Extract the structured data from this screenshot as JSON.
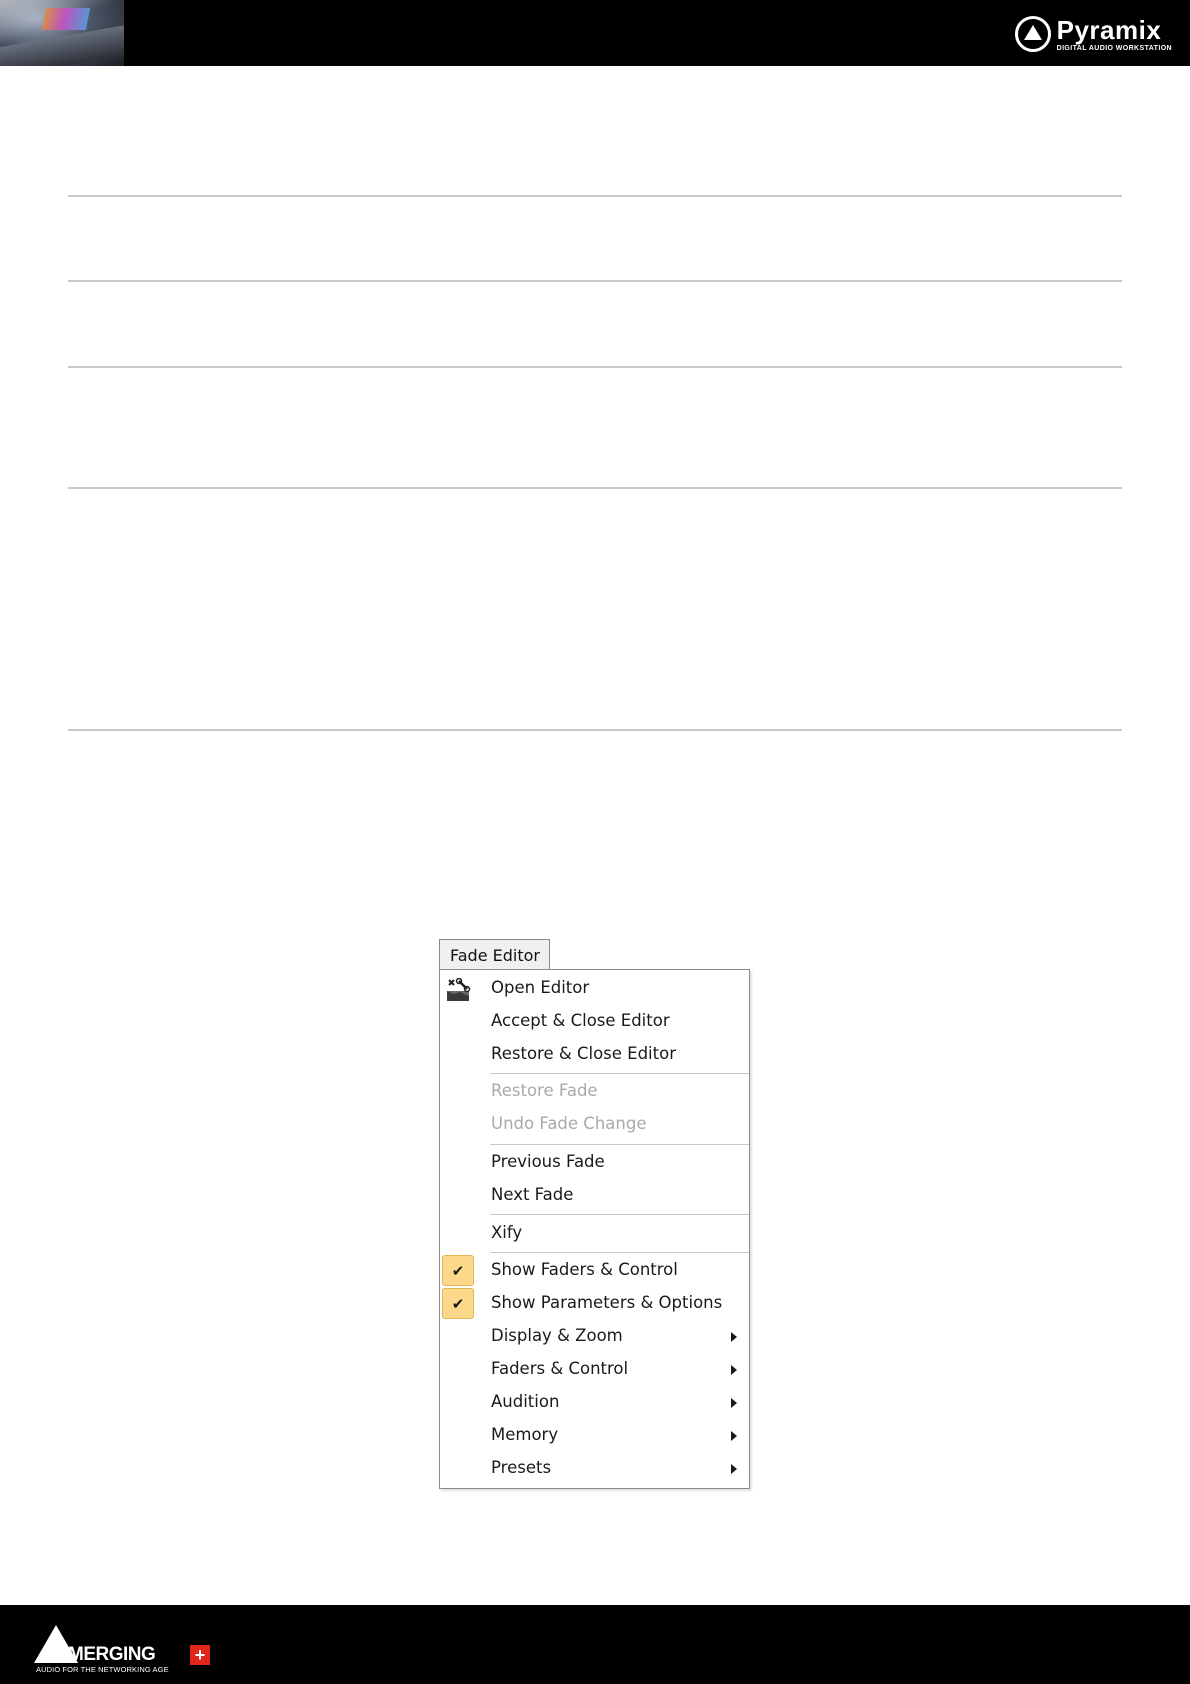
{
  "header": {
    "brand_name": "Pyramix",
    "brand_subtitle": "DIGITAL AUDIO WORKSTATION"
  },
  "menu": {
    "title": "Fade Editor",
    "items": [
      {
        "label": "Open Editor",
        "icon": "editor-tool-icon",
        "enabled": true
      },
      {
        "label": "Accept & Close Editor",
        "enabled": true
      },
      {
        "label": "Restore & Close Editor",
        "enabled": true
      },
      {
        "label": "Restore Fade",
        "enabled": false
      },
      {
        "label": "Undo Fade Change",
        "enabled": false
      },
      {
        "label": "Previous Fade",
        "enabled": true
      },
      {
        "label": "Next Fade",
        "enabled": true
      },
      {
        "label": "Xify",
        "enabled": true
      },
      {
        "label": "Show Faders & Control",
        "checked": true,
        "enabled": true
      },
      {
        "label": "Show Parameters & Options",
        "checked": true,
        "enabled": true
      },
      {
        "label": "Display & Zoom",
        "submenu": true,
        "enabled": true
      },
      {
        "label": "Faders & Control",
        "submenu": true,
        "enabled": true
      },
      {
        "label": "Audition",
        "submenu": true,
        "enabled": true
      },
      {
        "label": "Memory",
        "submenu": true,
        "enabled": true
      },
      {
        "label": "Presets",
        "submenu": true,
        "enabled": true
      }
    ],
    "check_glyph": "✔"
  },
  "footer": {
    "brand_name": "MERGING",
    "brand_plus": "+",
    "tagline": "AUDIO FOR THE NETWORKING AGE"
  },
  "colors": {
    "band": "#000000",
    "check_highlight": "#fbd88a",
    "disabled_text": "#a9a9a9",
    "rule": "#c8c8c8",
    "merging_red": "#e1251b"
  }
}
